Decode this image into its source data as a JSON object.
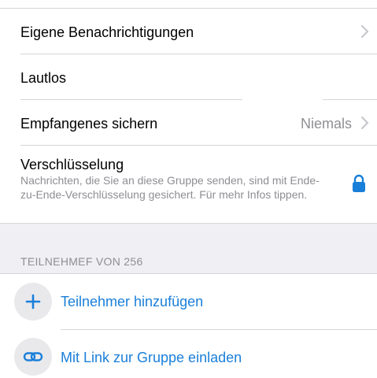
{
  "settings": {
    "custom_notifications": {
      "label": "Eigene Benachrichtigungen"
    },
    "mute": {
      "label": "Lautlos"
    },
    "save_to_camera_roll": {
      "label": "Empfangenes sichern",
      "value": "Niemals"
    },
    "encryption": {
      "label": "Verschlüsselung",
      "description": "Nachrichten, die Sie an diese Gruppe senden, sind mit Ende-zu-Ende-Verschlüsselung gesichert. Für mehr Infos tippen."
    }
  },
  "participants": {
    "section_title": "TEILNEHMEF    VON 256",
    "add_participant_label": "Teilnehmer hinzufügen",
    "invite_link_label": "Mit Link zur Gruppe einladen"
  },
  "colors": {
    "accent": "#1a7fd9",
    "secondary_text": "#8e8e93",
    "group_background": "#efeff4",
    "separator": "#d6d6d9"
  },
  "icons": {
    "chevron": "chevron-right-icon",
    "lock": "lock-icon",
    "add": "plus-icon",
    "link": "link-icon"
  }
}
